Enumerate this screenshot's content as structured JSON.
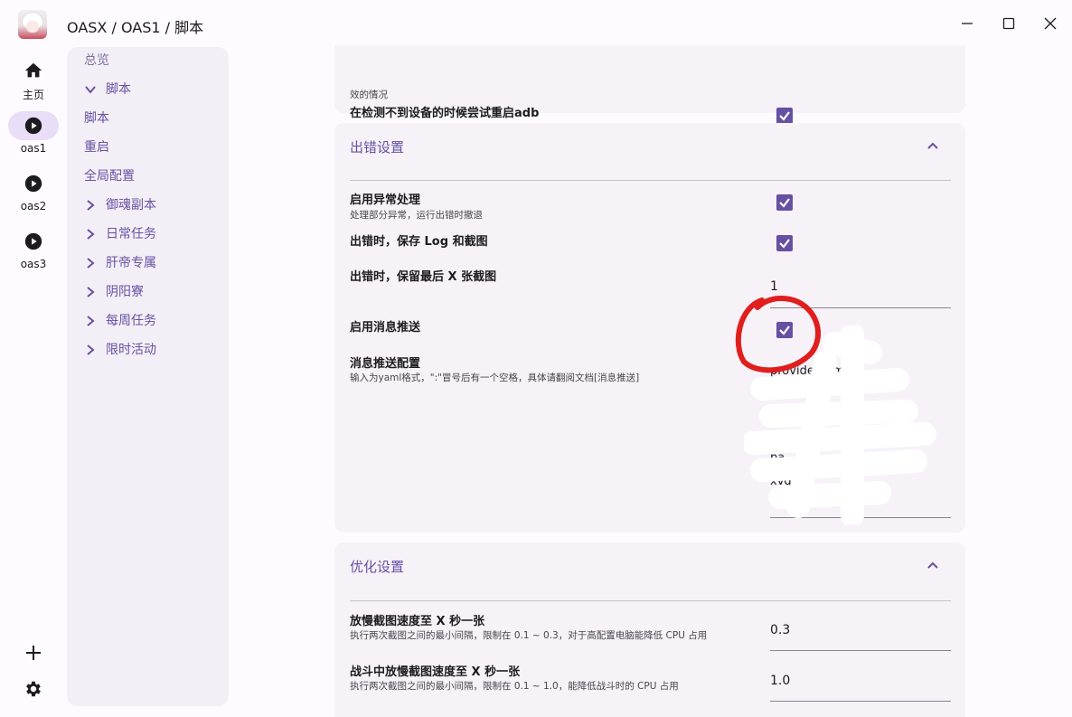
{
  "titlebar": {
    "breadcrumb": "OASX / OAS1 /  脚本",
    "minimize_icon": "minimize-icon",
    "maximize_icon": "maximize-icon",
    "close_icon": "close-icon"
  },
  "rail": {
    "items": [
      {
        "label": "主页",
        "icon": "home-icon"
      },
      {
        "label": "oas1",
        "icon": "play-icon",
        "active": true
      },
      {
        "label": "oas2",
        "icon": "play-icon"
      },
      {
        "label": "oas3",
        "icon": "play-icon"
      }
    ],
    "add_icon": "add-icon",
    "settings_icon": "gear-icon"
  },
  "nav": {
    "items": [
      {
        "label": "总览"
      },
      {
        "label": "脚本",
        "expanded": true
      },
      {
        "label": "脚本"
      },
      {
        "label": "重启"
      },
      {
        "label": "全局配置"
      },
      {
        "label": "御魂副本"
      },
      {
        "label": "日常任务"
      },
      {
        "label": "肝帝专属"
      },
      {
        "label": "阴阳寮"
      },
      {
        "label": "每周任务"
      },
      {
        "label": "限时活动"
      }
    ]
  },
  "card_top": {
    "cut_help": "效的情况",
    "restart_adb_label": "在检测不到设备的时候尝试重启adb",
    "restart_adb_checked": true
  },
  "error_settings": {
    "title": "出错设置",
    "handle_exception_label": "启用异常处理",
    "handle_exception_help": "处理部分异常，运行出错时撤退",
    "handle_exception_checked": true,
    "save_log_label": "出错时，保存 Log 和截图",
    "save_log_checked": true,
    "keep_screenshots_label": "出错时，保留最后 X 张截图",
    "keep_screenshots_value": "1",
    "notify_label": "启用消息推送",
    "notify_checked": true,
    "notify_config_label": "消息推送配置",
    "notify_config_help": "输入为yaml格式，\":\"冒号后有一个空格，具体请翻阅文档[消息推送]",
    "notify_config_lines": [
      "provider: smtp",
      "",
      "",
      "",
      "pa",
      "xvq"
    ]
  },
  "optimize_settings": {
    "title": "优化设置",
    "screenshot_interval_label": "放慢截图速度至 X 秒一张",
    "screenshot_interval_help": "执行两次截图之间的最小间隔，限制在 0.1 ~ 0.3，对于高配置电脑能降低 CPU 占用",
    "screenshot_interval_value": "0.3",
    "combat_interval_label": "战斗中放慢截图速度至 X 秒一张",
    "combat_interval_help": "执行两次截图之间的最小间隔，限制在 0.1 ~ 1.0，能降低战斗时的 CPU 占用",
    "combat_interval_value": "1.0",
    "next_label_partial": "..."
  },
  "colors": {
    "accent": "#6750a4",
    "annotation_red": "#e01e1e"
  }
}
